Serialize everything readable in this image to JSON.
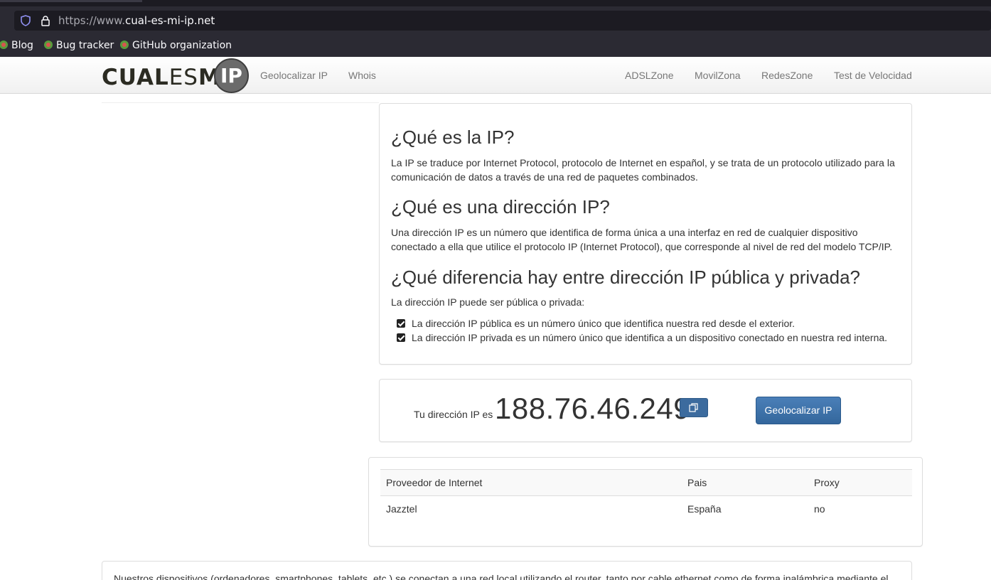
{
  "browser": {
    "url_proto": "https://www.",
    "url_host": "cual-es-mi-ip.net",
    "bookmarks": [
      "Blog",
      "Bug tracker",
      "GitHub organization"
    ]
  },
  "nav": {
    "logo_bold": "CUAL",
    "logo_thin": "ES",
    "logo_bold2": "MI",
    "logo_badge": "IP",
    "left_links": [
      "Geolocalizar IP",
      "Whois"
    ],
    "right_links": [
      "ADSLZone",
      "MovilZona",
      "RedesZone",
      "Test de Velocidad"
    ]
  },
  "info": {
    "h1": "¿Qué es la IP?",
    "p1": "La IP se traduce por Internet Protocol, protocolo de Internet en español, y se trata de un protocolo utilizado para la comunicación de datos a través de una red de paquetes combinados.",
    "h2": "¿Qué es una dirección IP?",
    "p2": "Una dirección IP es un número que identifica de forma única a una interfaz en red de cualquier dispositivo conectado a ella que utilice el protocolo IP (Internet Protocol), que corresponde al nivel de red del modelo TCP/IP.",
    "h3": "¿Qué diferencia hay entre dirección IP pública y privada?",
    "p3": "La dirección IP puede ser pública o privada:",
    "checks": [
      "La dirección IP pública es un número único que identifica nuestra red desde el exterior.",
      "La dirección IP privada es un número único que identifica a un dispositivo conectado en nuestra red interna."
    ]
  },
  "ip": {
    "label": "Tu dirección IP es",
    "value": "188.76.46.249",
    "geo_button": "Geolocalizar IP"
  },
  "table": {
    "headers": [
      "Proveedor de Internet",
      "Pais",
      "Proxy"
    ],
    "row": [
      "Jazztel",
      "España",
      "no"
    ]
  },
  "bottom": {
    "text": "Nuestros dispositivos (ordenadores, smartphones, tablets, etc.) se conectan a una red local utilizando el router, tanto por cable ethernet como de forma inalámbrica mediante el"
  },
  "colors": {
    "primary_button": "#34679c",
    "browser_chrome": "#2b2a33"
  }
}
